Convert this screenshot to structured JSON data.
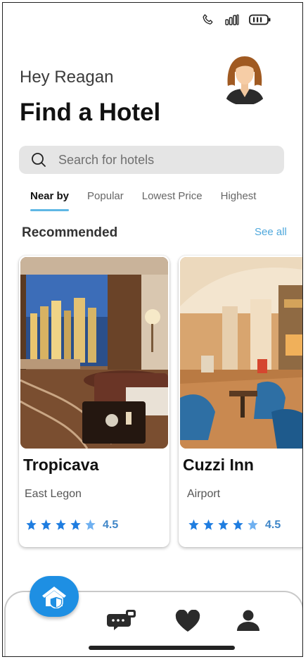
{
  "status_bar": {
    "icons": [
      "phone-icon",
      "signal-icon",
      "battery-icon"
    ]
  },
  "header": {
    "greeting": "Hey Reagan",
    "title": "Find a Hotel",
    "avatar": "user-avatar"
  },
  "search": {
    "placeholder": "Search for hotels",
    "icon": "search-icon"
  },
  "tabs": [
    {
      "label": "Near by",
      "active": true
    },
    {
      "label": "Popular",
      "active": false
    },
    {
      "label": "Lowest Price",
      "active": false
    },
    {
      "label": "Highest",
      "active": false
    }
  ],
  "section": {
    "title": "Recommended",
    "see_all": "See all"
  },
  "hotels": [
    {
      "name": "Tropicava",
      "location": "East Legon",
      "rating": "4.5"
    },
    {
      "name": "Cuzzi Inn",
      "location": "Airport",
      "rating": "4.5"
    }
  ],
  "bottom_nav": {
    "items": [
      "home-icon",
      "chat-icon",
      "heart-icon",
      "profile-icon"
    ],
    "active": "home-icon"
  },
  "colors": {
    "accent": "#1e8fe3",
    "tab_underline": "#5fb7e5",
    "link": "#4fa8dc",
    "star": "#1f7de0",
    "star_partial": "#6fb0f0"
  }
}
